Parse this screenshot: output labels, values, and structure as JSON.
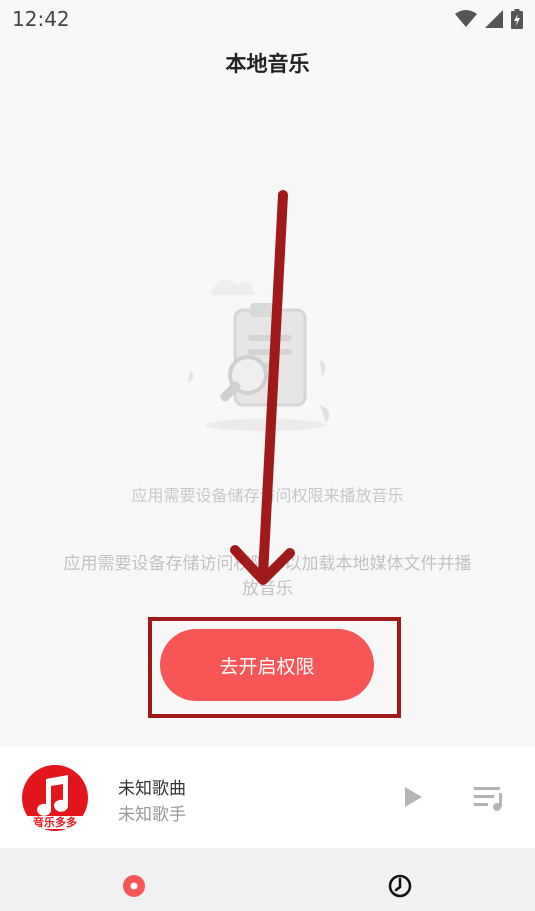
{
  "status_bar": {
    "time": "12:42",
    "icons": [
      "wifi-icon",
      "cellular-signal-icon",
      "battery-charging-icon"
    ]
  },
  "header": {
    "title": "本地音乐"
  },
  "empty_state": {
    "illustration_icon": "document-search-icon",
    "caption": "应用需要设备储存访问权限来播放音乐",
    "description": "应用需要设备存储访问权限，以加载本地媒体文件并播放音乐",
    "button_label": "去开启权限"
  },
  "mini_player": {
    "album_art_text": "音乐多多",
    "song_title": "未知歌曲",
    "artist": "未知歌手",
    "play_icon": "play-icon",
    "playlist_icon": "playlist-icon"
  },
  "bottom_nav": {
    "tabs": [
      {
        "icon": "music-disc-icon",
        "active": true
      },
      {
        "icon": "recent-icon",
        "active": false
      }
    ]
  },
  "colors": {
    "accent": "#f75556",
    "annotation": "#a11a1a",
    "brand_red": "#e3161c"
  }
}
